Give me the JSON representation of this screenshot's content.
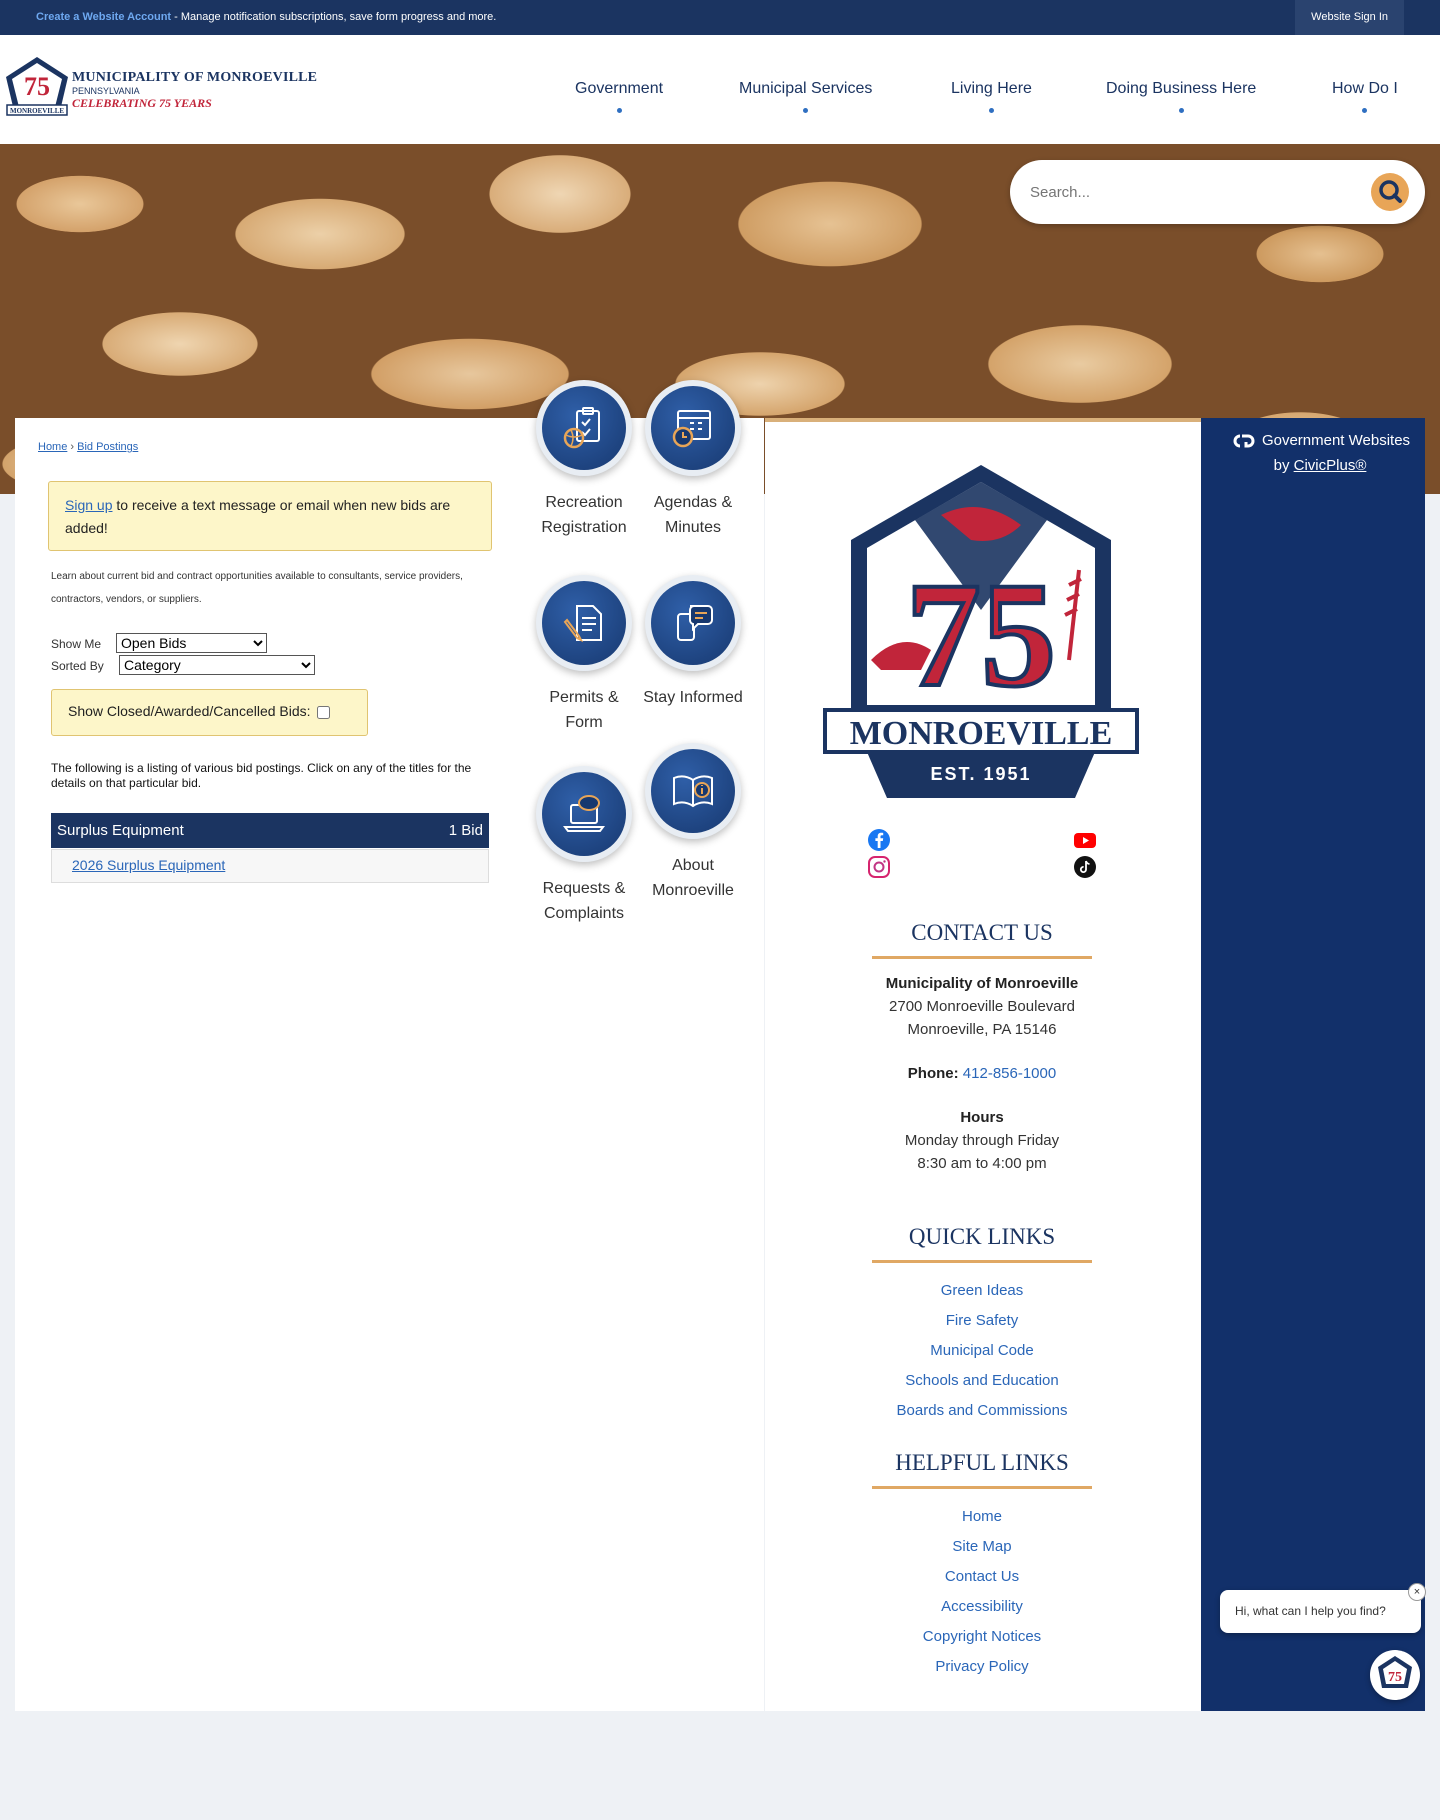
{
  "topbar": {
    "create_link": "Create a Website Account",
    "message": " - Manage notification subscriptions, save form progress and more.",
    "signin": "Website Sign In"
  },
  "logo": {
    "line1": "MUNICIPALITY OF MONROEVILLE",
    "line2": "PENNSYLVANIA",
    "line3": "CELEBRATING 75 YEARS"
  },
  "nav": {
    "items": [
      {
        "label": "Government"
      },
      {
        "label": "Municipal Services"
      },
      {
        "label": "Living Here"
      },
      {
        "label": "Doing Business Here"
      },
      {
        "label": "How Do I"
      }
    ]
  },
  "search": {
    "placeholder": "Search..."
  },
  "breadcrumb": {
    "home": "Home",
    "separator": " › ",
    "current": "Bid Postings"
  },
  "notice": {
    "link": "Sign up",
    "text": " to receive a text message or email when new bids are added!"
  },
  "intro": "Learn about current bid and contract opportunities available to consultants, service providers, contractors, vendors, or suppliers.",
  "filters": {
    "show_me_label": "Show Me",
    "show_me_value": "Open Bids",
    "sorted_by_label": "Sorted By",
    "sorted_by_value": "Category",
    "closed_label": "Show Closed/Awarded/Cancelled Bids:"
  },
  "listing_text": "The following is a listing of various bid postings. Click on any of the titles for the details on that particular bid.",
  "bids": {
    "category": "Surplus Equipment",
    "count": "1 Bid",
    "items": [
      {
        "title": "2026 Surplus Equipment"
      }
    ]
  },
  "quick_icons": [
    {
      "label": "Recreation Registration",
      "icon": "clipboard-ball-icon"
    },
    {
      "label": "Agendas & Minutes",
      "icon": "calendar-clock-icon"
    },
    {
      "label": "Permits & Form",
      "icon": "document-pen-icon"
    },
    {
      "label": "Stay Informed",
      "icon": "phone-chat-icon"
    },
    {
      "label": "Requests & Complaints",
      "icon": "laptop-chat-icon"
    },
    {
      "label": "About Monroeville",
      "icon": "book-info-icon"
    }
  ],
  "seal": {
    "number": "75",
    "name": "MONROEVILLE",
    "est": "EST. 1951"
  },
  "contact": {
    "title": "CONTACT US",
    "org": "Municipality of Monroeville",
    "address1": "2700 Monroeville Boulevard",
    "address2": "Monroeville, PA 15146",
    "phone_label": "Phone:",
    "phone": "412-856-1000",
    "hours_label": "Hours",
    "hours1": "Monday through Friday",
    "hours2": "8:30 am to 4:00 pm"
  },
  "quick_links": {
    "title": "QUICK LINKS",
    "items": [
      "Green Ideas",
      "Fire Safety",
      "Municipal Code",
      "Schools and Education",
      "Boards and Commissions"
    ]
  },
  "helpful_links": {
    "title": "HELPFUL LINKS",
    "items": [
      "Home",
      "Site Map",
      "Contact Us",
      "Accessibility",
      "Copyright Notices",
      "Privacy Policy"
    ]
  },
  "civicplus": {
    "line1": "Government Websites",
    "by": "by ",
    "link": "CivicPlus®"
  },
  "chat": {
    "prompt": "Hi, what can I help you find?",
    "close": "×"
  },
  "colors": {
    "navy": "#1b3461",
    "accent": "#e0a864",
    "link": "#2a66b8",
    "red": "#c1253a"
  }
}
